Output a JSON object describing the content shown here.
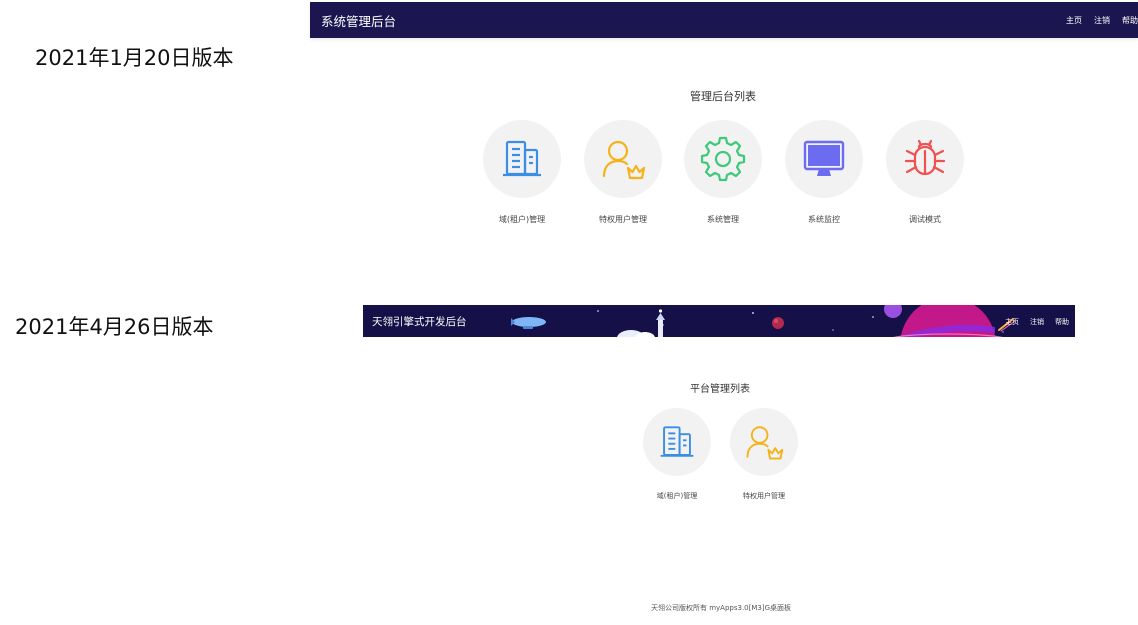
{
  "labels": {
    "version_1": "2021年1月20日版本",
    "version_2": "2021年4月26日版本"
  },
  "old_version": {
    "header": {
      "title": "系统管理后台",
      "nav": [
        "主页",
        "注销",
        "帮助"
      ]
    },
    "section_title": "管理后台列表",
    "tiles": [
      {
        "label": "域(租户)管理",
        "icon": "building-icon",
        "color": "#3a8ee6"
      },
      {
        "label": "特权用户管理",
        "icon": "user-crown-icon",
        "color": "#f5b21a"
      },
      {
        "label": "系统管理",
        "icon": "gear-icon",
        "color": "#3ec97a"
      },
      {
        "label": "系统监控",
        "icon": "monitor-icon",
        "color": "#6c6cf0"
      },
      {
        "label": "调试模式",
        "icon": "bug-icon",
        "color": "#f05050"
      }
    ]
  },
  "new_version": {
    "header": {
      "title": "天翎引擎式开发后台",
      "nav": [
        "主页",
        "注销",
        "帮助"
      ]
    },
    "section_title": "平台管理列表",
    "tiles": [
      {
        "label": "域(租户)管理",
        "icon": "building-icon",
        "color": "#3a8ee6"
      },
      {
        "label": "特权用户管理",
        "icon": "user-crown-icon",
        "color": "#f5b21a"
      }
    ],
    "footer": "天翎公司版权所有 myApps3.0[M3]G桌面板"
  },
  "colors": {
    "header_bg": "#1c1650",
    "tile_bg": "#f2f2f2"
  }
}
